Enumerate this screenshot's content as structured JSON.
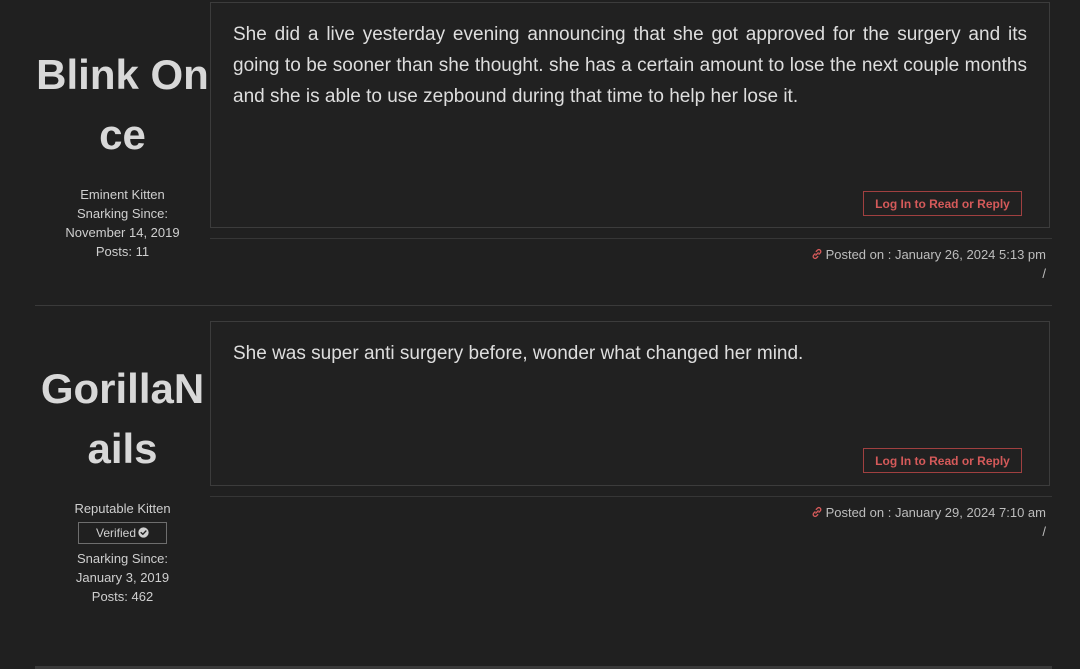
{
  "posts": [
    {
      "author": {
        "name": "Blink Once",
        "rank": "Eminent Kitten",
        "snarking_label": "Snarking Since:",
        "snarking_date": "November 14, 2019",
        "posts": "Posts: 11"
      },
      "body": "She did a live yesterday evening announcing that she got approved for the surgery and its going to be sooner than she thought.  she has a certain amount to lose the next couple months and she is able to use zepbound during that time to help her lose it.",
      "reply_label": "Log In to Read or Reply",
      "posted_on": "Posted on : January 26, 2024 5:13 pm",
      "separator": "/"
    },
    {
      "author": {
        "name": "GorillaNails",
        "rank": "Reputable Kitten",
        "badge": "Verified",
        "snarking_label": "Snarking Since:",
        "snarking_date": "January 3, 2019",
        "posts": "Posts: 462"
      },
      "body": "She was super anti surgery before, wonder what changed her mind.",
      "reply_label": "Log In to Read or Reply",
      "posted_on": "Posted on : January 29, 2024 7:10 am",
      "separator": "/"
    }
  ],
  "colors": {
    "background": "#202020",
    "accent": "#d55a5a",
    "text": "#dedede"
  }
}
